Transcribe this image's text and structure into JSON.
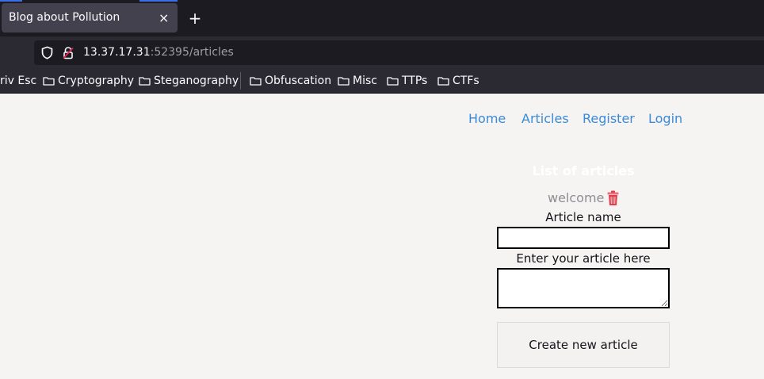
{
  "browser": {
    "tab": {
      "title": "Blog about Pollution",
      "close_glyph": "×"
    },
    "new_tab_glyph": "+",
    "url": {
      "host": "13.37.17.31",
      "rest": ":52395/articles"
    },
    "bookmarks": [
      {
        "label": "riv Esc",
        "icon": "folder-icon"
      },
      {
        "label": "Cryptography",
        "icon": "folder-icon"
      },
      {
        "label": "Steganography",
        "icon": "folder-icon"
      },
      {
        "label": "Obfuscation",
        "icon": "folder-icon"
      },
      {
        "label": "Misc",
        "icon": "folder-icon"
      },
      {
        "label": "TTPs",
        "icon": "folder-icon"
      },
      {
        "label": "CTFs",
        "icon": "folder-icon"
      }
    ],
    "colors": {
      "tabbar": "#1c1b22",
      "toolbar": "#2b2a33",
      "accent": "#3d6ee8"
    }
  },
  "nav": {
    "home": "Home",
    "articles": "Articles",
    "register": "Register",
    "login": "Login"
  },
  "articles": {
    "heading": "List of articles",
    "items": [
      {
        "name": "welcome",
        "delete_icon": "trash-icon"
      }
    ]
  },
  "form": {
    "name_label": "Article name",
    "name_value": "",
    "body_label": "Enter your article here",
    "body_value": "",
    "submit_label": "Create new article"
  },
  "colors": {
    "link": "#3b8ad8",
    "background": "#f5f4f2",
    "trash": "#e0404d"
  }
}
